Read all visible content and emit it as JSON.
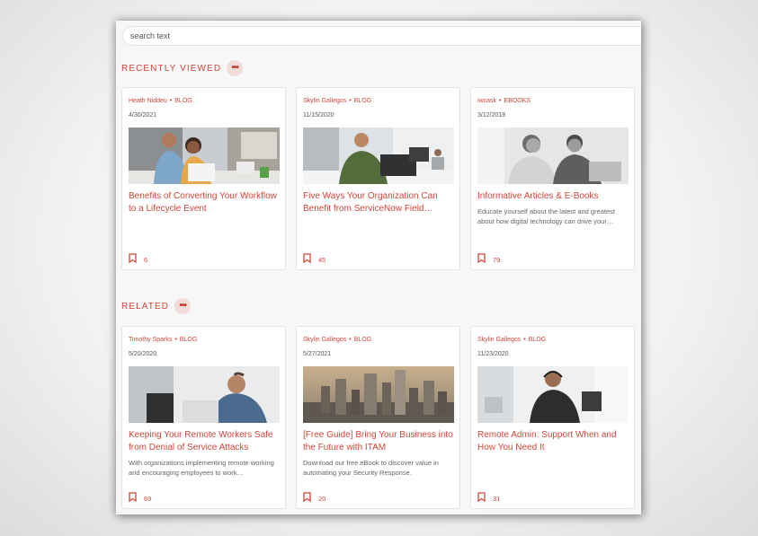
{
  "search": {
    "value": "search text"
  },
  "sections": {
    "recently_viewed": {
      "title": "RECENTLY VIEWED",
      "more_icon": "•••",
      "cards": [
        {
          "author": "Heath Niddeu",
          "type": "BLOG",
          "date": "4/30/2021",
          "title": "Benefits of Converting Your Workflow to a Lifecycle Event",
          "description": "",
          "bookmarks": "6",
          "image": "colleagues-reviewing-document"
        },
        {
          "author": "Skylin Gallegos",
          "type": "BLOG",
          "date": "11/15/2020",
          "title": "Five Ways Your Organization Can Benefit from ServiceNow Field…",
          "description": "",
          "bookmarks": "45",
          "image": "man-smiling-at-laptop"
        },
        {
          "author": "iwcask",
          "type": "EBOOKS",
          "date": "3/12/2019",
          "title": "Informative Articles & E-Books",
          "description": "Educate yourself about the latest and greatest about how digital technology can drive your…",
          "bookmarks": "79",
          "image": "two-people-grayscale"
        }
      ]
    },
    "related": {
      "title": "RELATED",
      "more_icon": "•••",
      "cards": [
        {
          "author": "Timothy Sparks",
          "type": "BLOG",
          "date": "5/20/2020",
          "title": "Keeping Your Remote Workers Safe from Denial of Service Attacks",
          "description": "With organizations implementing remote working and encouraging employees to work…",
          "bookmarks": "69",
          "image": "man-at-desk"
        },
        {
          "author": "Skylin Gallegos",
          "type": "BLOG",
          "date": "5/27/2021",
          "title": "[Free Guide] Bring Your Business into the Future with ITAM",
          "description": "Download our free eBook to discover value in automating your Security Response.",
          "bookmarks": "20",
          "image": "city-skyline"
        },
        {
          "author": "Skylin Gallegos",
          "type": "BLOG",
          "date": "11/23/2020",
          "title": "Remote Admin: Support When and How You Need It",
          "description": "",
          "bookmarks": "31",
          "image": "support-agent-headset"
        }
      ]
    }
  },
  "colors": {
    "accent": "#d2463a",
    "panel": "#f7f7f7",
    "card": "#ffffff"
  }
}
